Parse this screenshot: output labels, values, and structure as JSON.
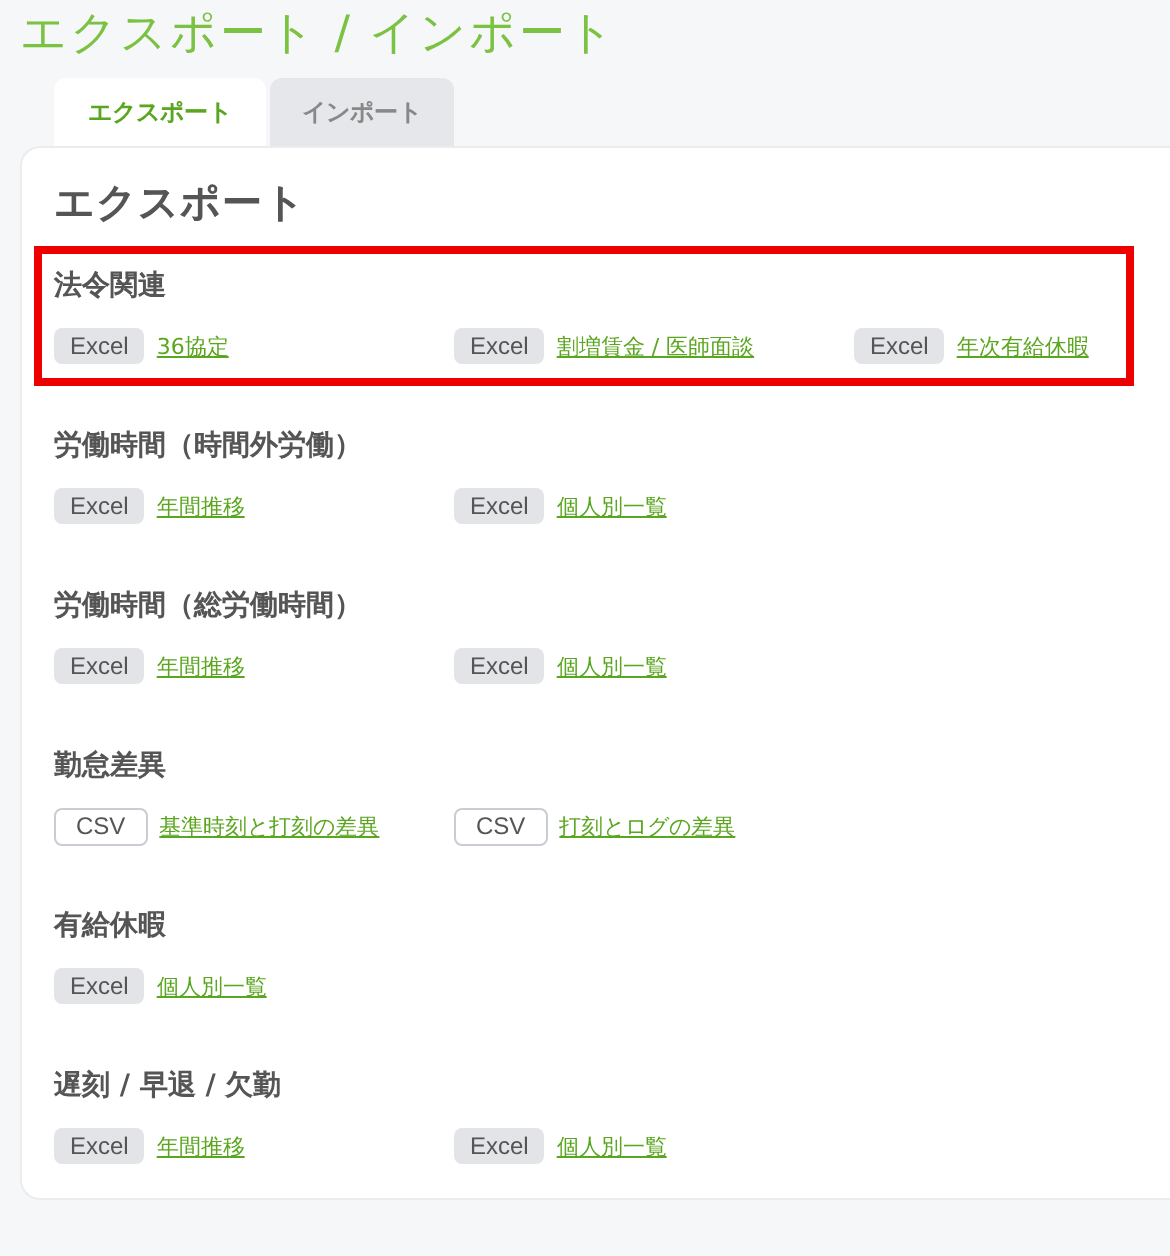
{
  "page_title": "エクスポート / インポート",
  "tabs": [
    {
      "label": "エクスポート",
      "selected": true
    },
    {
      "label": "インポート",
      "selected": false
    }
  ],
  "panel_title": "エクスポート",
  "sections": [
    {
      "title": "法令関連",
      "highlighted": true,
      "items": [
        {
          "kind": "excel",
          "format": "Excel",
          "label": "36協定"
        },
        {
          "kind": "excel",
          "format": "Excel",
          "label": "割増賃金 / 医師面談"
        },
        {
          "kind": "excel",
          "format": "Excel",
          "label": "年次有給休暇"
        }
      ]
    },
    {
      "title": "労働時間（時間外労働）",
      "highlighted": false,
      "items": [
        {
          "kind": "excel",
          "format": "Excel",
          "label": "年間推移"
        },
        {
          "kind": "excel",
          "format": "Excel",
          "label": "個人別一覧"
        }
      ]
    },
    {
      "title": "労働時間（総労働時間）",
      "highlighted": false,
      "items": [
        {
          "kind": "excel",
          "format": "Excel",
          "label": "年間推移"
        },
        {
          "kind": "excel",
          "format": "Excel",
          "label": "個人別一覧"
        }
      ]
    },
    {
      "title": "勤怠差異",
      "highlighted": false,
      "items": [
        {
          "kind": "csv",
          "format": "CSV",
          "label": "基準時刻と打刻の差異"
        },
        {
          "kind": "csv",
          "format": "CSV",
          "label": "打刻とログの差異"
        }
      ]
    },
    {
      "title": "有給休暇",
      "highlighted": false,
      "items": [
        {
          "kind": "excel",
          "format": "Excel",
          "label": "個人別一覧"
        }
      ]
    },
    {
      "title": "遅刻 / 早退 / 欠勤",
      "highlighted": false,
      "items": [
        {
          "kind": "excel",
          "format": "Excel",
          "label": "年間推移"
        },
        {
          "kind": "excel",
          "format": "Excel",
          "label": "個人別一覧"
        }
      ]
    }
  ]
}
